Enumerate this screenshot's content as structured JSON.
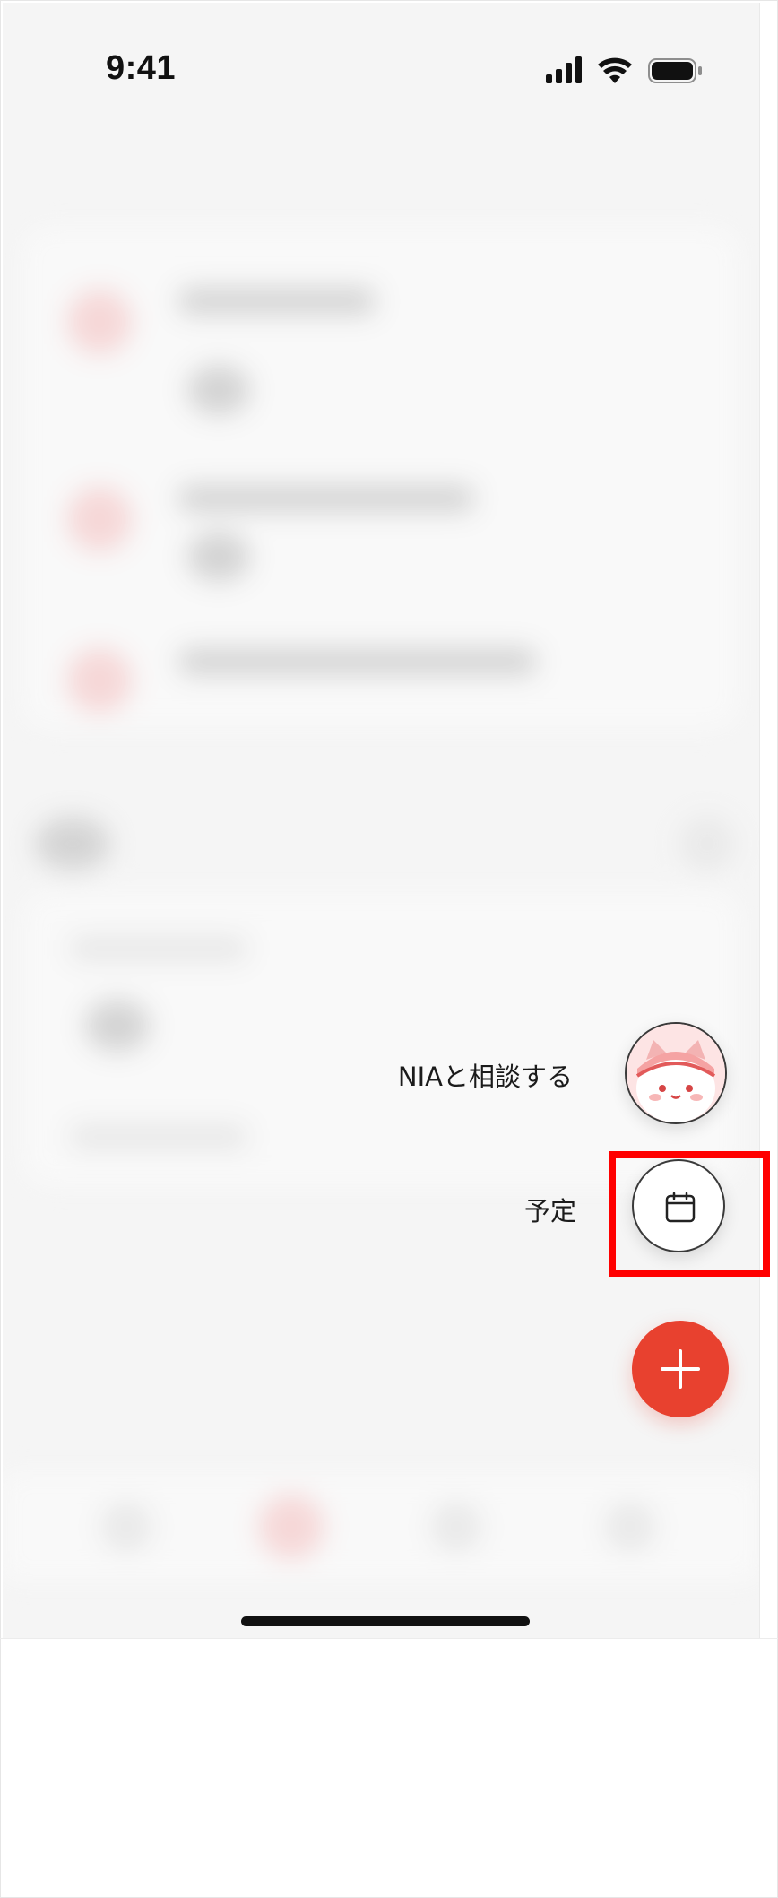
{
  "status_bar": {
    "time": "9:41",
    "icons": [
      "cellular-signal-icon",
      "wifi-icon",
      "battery-icon"
    ]
  },
  "fab_menu": {
    "nia_label": "NIAと相談する",
    "schedule_label": "予定",
    "add_icon": "plus-icon",
    "schedule_icon": "calendar-icon",
    "nia_avatar": "nia-mascot-avatar"
  },
  "colors": {
    "accent": "#e8412f",
    "highlight": "#ff0000",
    "background": "#f4f4f4"
  }
}
